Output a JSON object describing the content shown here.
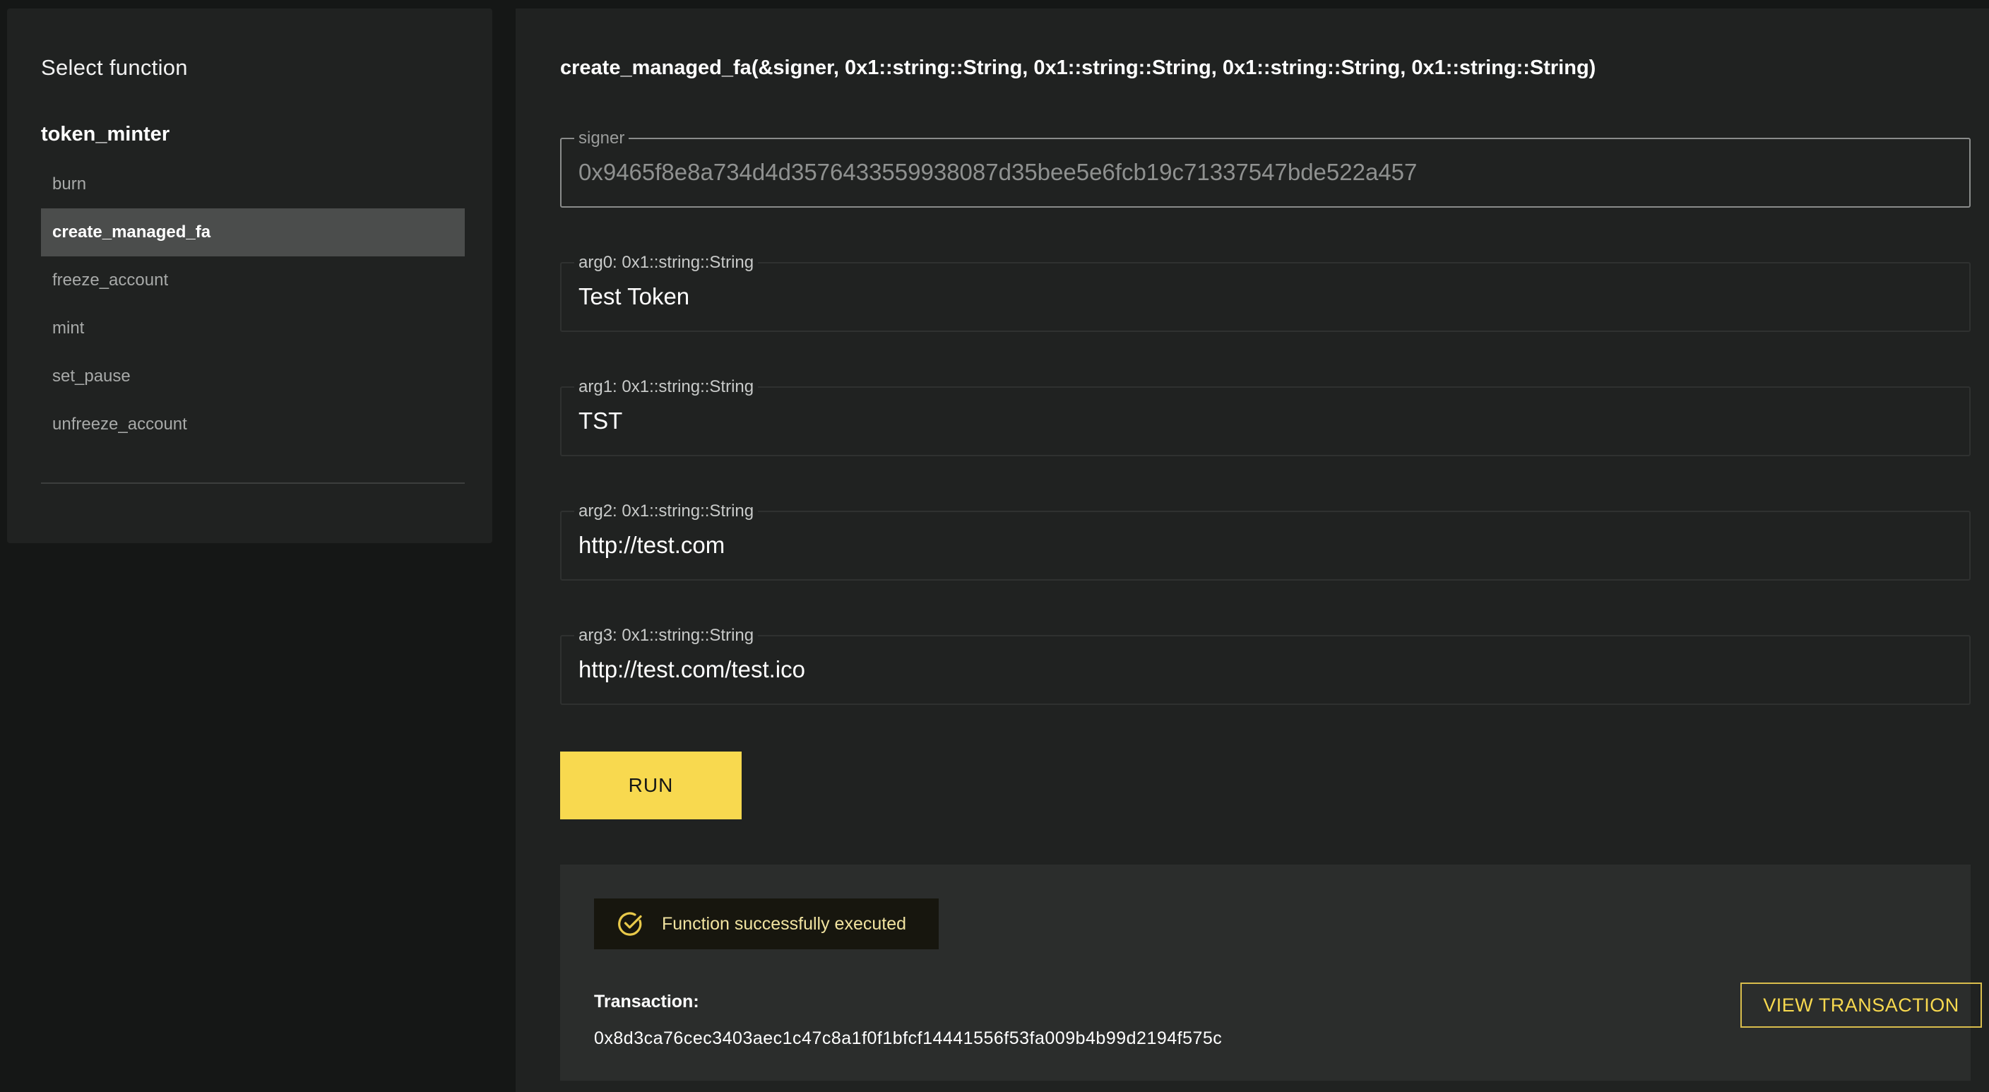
{
  "sidebar": {
    "heading": "Select function",
    "module": "token_minter",
    "functions": [
      {
        "label": "burn"
      },
      {
        "label": "create_managed_fa",
        "selected": true
      },
      {
        "label": "freeze_account"
      },
      {
        "label": "mint"
      },
      {
        "label": "set_pause"
      },
      {
        "label": "unfreeze_account"
      }
    ]
  },
  "main": {
    "signature": "create_managed_fa(&signer, 0x1::string::String, 0x1::string::String, 0x1::string::String, 0x1::string::String)",
    "fields": [
      {
        "label": "signer",
        "value": "0x9465f8e8a734d4d3576433559938087d35bee5e6fcb19c71337547bde522a457"
      },
      {
        "label": "arg0: 0x1::string::String",
        "value": "Test Token"
      },
      {
        "label": "arg1: 0x1::string::String",
        "value": "TST"
      },
      {
        "label": "arg2: 0x1::string::String",
        "value": "http://test.com"
      },
      {
        "label": "arg3: 0x1::string::String",
        "value": "http://test.com/test.ico"
      }
    ],
    "run_label": "RUN",
    "result": {
      "status_icon": "check-circle-icon",
      "status_message": "Function successfully executed",
      "transaction_label": "Transaction:",
      "transaction_hash": "0x8d3ca76cec3403aec1c47c8a1f0f1bfcf14441556f53fa009b4b99d2194f575c",
      "view_label": "VIEW TRANSACTION"
    }
  },
  "colors": {
    "background": "#151716",
    "panel": "#202221",
    "accent": "#f8d94f",
    "selected_item": "#4b4d4c"
  }
}
